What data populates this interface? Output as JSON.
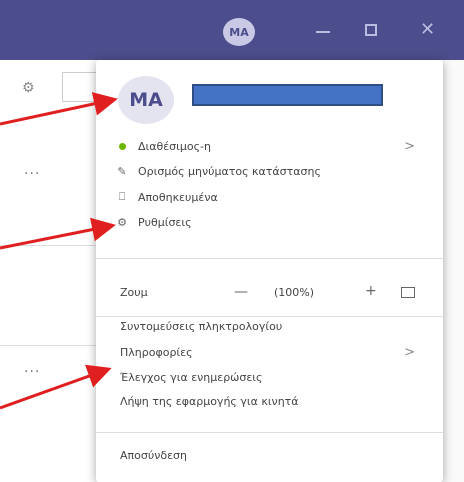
{
  "titlebar": {
    "avatar_initials": "MA"
  },
  "profile": {
    "initials": "MA"
  },
  "menu": {
    "status": "Διαθέσιμος-η",
    "set_status_message": "Ορισμός μηνύματος κατάστασης",
    "saved": "Αποθηκευμένα",
    "settings": "Ρυθμίσεις",
    "zoom_label": "Ζουμ",
    "zoom_value": "(100%)",
    "zoom_minus": "—",
    "zoom_plus": "+",
    "keyboard_shortcuts": "Συντομεύσεις πληκτρολογίου",
    "about": "Πληροφορίες",
    "check_updates": "Έλεγχος για ενημερώσεις",
    "download_mobile": "Λήψη της εφαρμογής για κινητά",
    "sign_out": "Αποσύνδεση"
  },
  "icons": {
    "status": "status-dot-icon",
    "set_status": "edit-status-icon",
    "saved": "bookmark-icon",
    "settings": "gear-icon",
    "fit": "fit-screen-icon"
  },
  "colors": {
    "titlebar": "#4b4d8c",
    "available": "#6bb700",
    "annotation_arrow": "#e02020",
    "redaction": "#4472c4"
  }
}
